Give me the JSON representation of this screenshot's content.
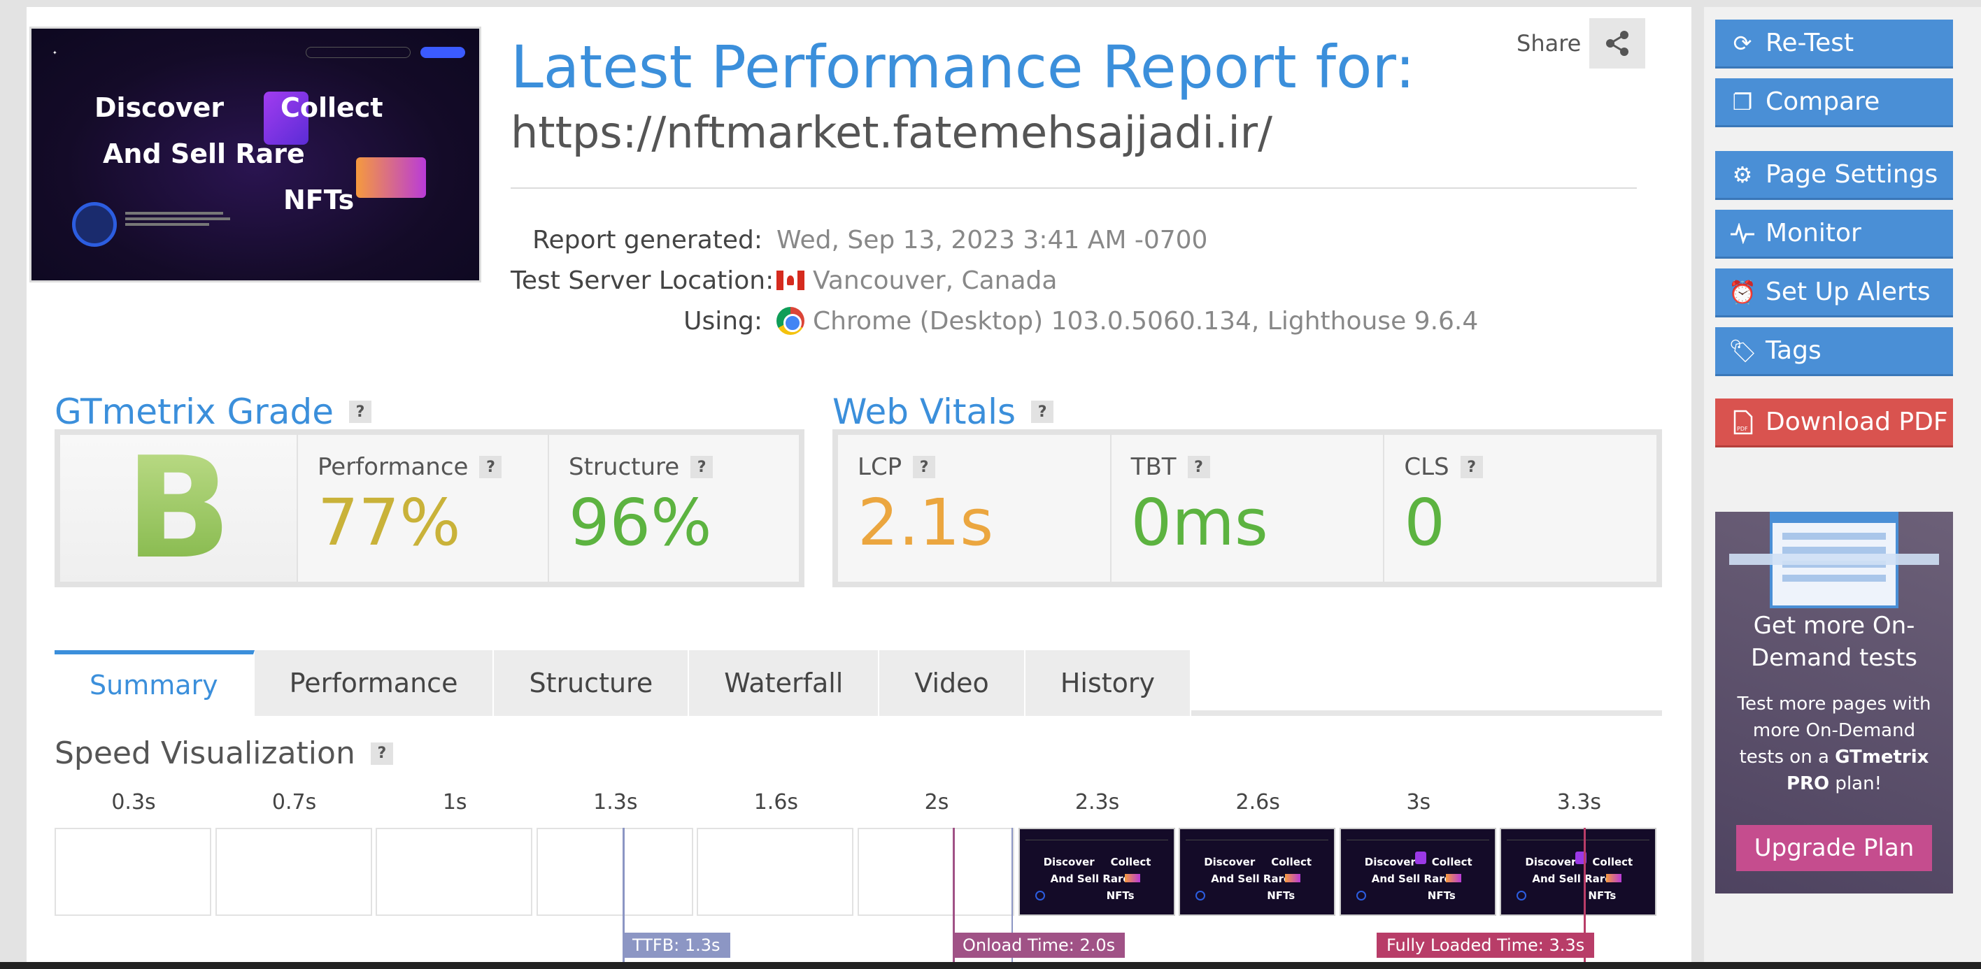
{
  "header": {
    "title": "Latest Performance Report for:",
    "url": "https://nftmarket.fatemehsajjadi.ir/",
    "share_label": "Share"
  },
  "thumbnail": {
    "line1a": "Discover",
    "line1b": "Collect",
    "line2": "And Sell Rare",
    "line3": "NFTs"
  },
  "meta": {
    "report_generated_label": "Report generated:",
    "report_generated_value": "Wed, Sep 13, 2023 3:41 AM -0700",
    "location_label": "Test Server Location:",
    "location_value": "Vancouver, Canada",
    "using_label": "Using:",
    "using_value": "Chrome (Desktop) 103.0.5060.134, Lighthouse 9.6.4"
  },
  "grade": {
    "heading": "GTmetrix Grade",
    "letter": "B",
    "performance_label": "Performance",
    "performance_value": "77%",
    "structure_label": "Structure",
    "structure_value": "96%"
  },
  "vitals": {
    "heading": "Web Vitals",
    "lcp_label": "LCP",
    "lcp_value": "2.1s",
    "tbt_label": "TBT",
    "tbt_value": "0ms",
    "cls_label": "CLS",
    "cls_value": "0"
  },
  "tabs": [
    "Summary",
    "Performance",
    "Structure",
    "Waterfall",
    "Video",
    "History"
  ],
  "speed": {
    "heading": "Speed Visualization",
    "times": [
      "0.3s",
      "0.7s",
      "1s",
      "1.3s",
      "1.6s",
      "2s",
      "2.3s",
      "2.6s",
      "3s",
      "3.3s"
    ],
    "ttfb": "TTFB: 1.3s",
    "onload": "Onload Time: 2.0s",
    "fully_loaded": "Fully Loaded Time: 3.3s",
    "frame_text": {
      "a": "Discover",
      "b": "Collect",
      "c": "And Sell Rare",
      "d": "NFTs"
    }
  },
  "sidebar": {
    "retest": "Re-Test",
    "compare": "Compare",
    "page_settings": "Page Settings",
    "monitor": "Monitor",
    "alerts": "Set Up Alerts",
    "tags": "Tags",
    "download": "Download PDF",
    "promo_heading": "Get more On-Demand tests",
    "promo_text_1": "Test more pages with more On-Demand tests on a ",
    "promo_text_brand": "GTmetrix PRO",
    "promo_text_2": " plan!",
    "upgrade": "Upgrade Plan"
  },
  "colors": {
    "accent": "#3b8fdb",
    "grade_b": "#8cc63f",
    "performance": "#c9b239",
    "structure": "#5cb340",
    "lcp": "#eba63f",
    "tbt": "#5cb340",
    "cls": "#5cb340",
    "ttfb_marker": "#8c96c4",
    "onload_marker": "#a05286",
    "fully_marker": "#b83d68",
    "download": "#d9534f",
    "upgrade": "#c54d8e"
  }
}
